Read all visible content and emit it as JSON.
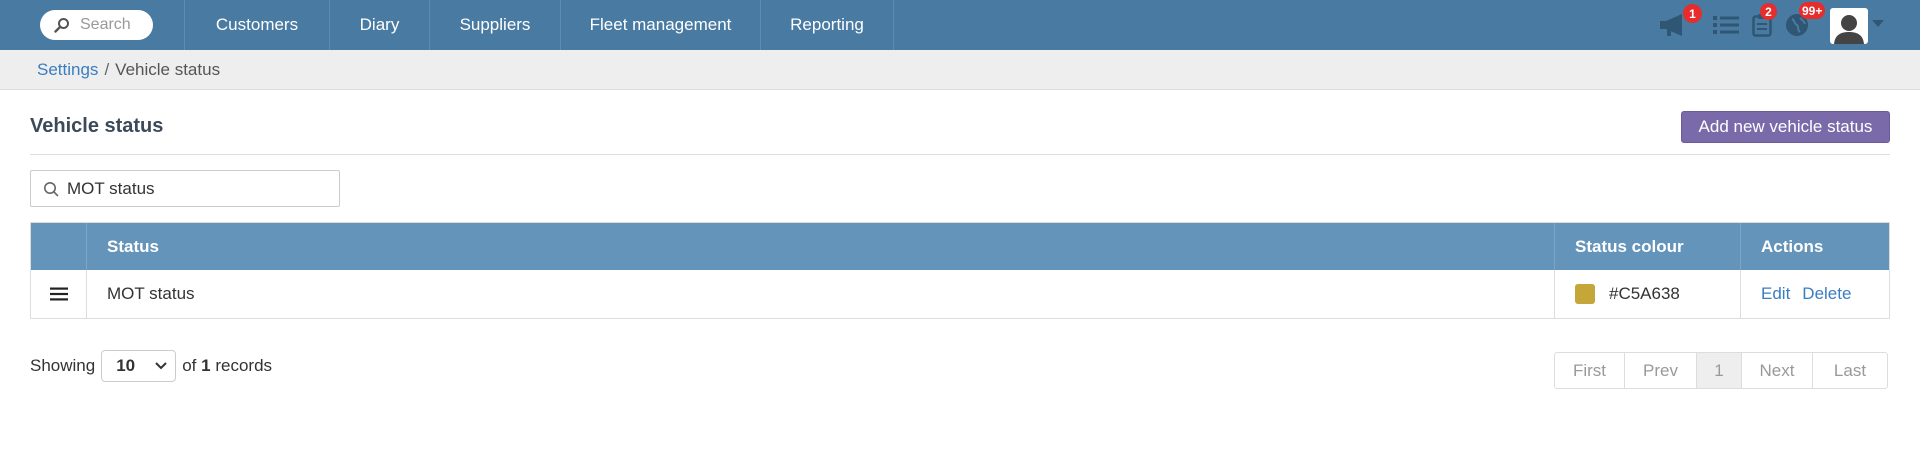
{
  "nav": {
    "search_placeholder": "Search",
    "items": [
      {
        "label": "Customers"
      },
      {
        "label": "Diary"
      },
      {
        "label": "Suppliers"
      },
      {
        "label": "Fleet management"
      },
      {
        "label": "Reporting"
      }
    ],
    "icons": {
      "announcements_badge": "1",
      "list_icon": "list-icon",
      "tasks_badge": "2",
      "globe_badge": "99+"
    }
  },
  "breadcrumb": {
    "parent": "Settings",
    "separator": "/",
    "current": "Vehicle status"
  },
  "page": {
    "title": "Vehicle status",
    "add_button": "Add new vehicle status",
    "filter_value": "MOT status"
  },
  "table": {
    "headers": {
      "status": "Status",
      "status_colour": "Status colour",
      "actions": "Actions"
    },
    "rows": [
      {
        "status": "MOT status",
        "colour_hex": "#C5A638",
        "colour_label": "#C5A638",
        "edit": "Edit",
        "delete": "Delete"
      }
    ]
  },
  "footer": {
    "showing_label": "Showing",
    "page_size": "10",
    "of_label": "of",
    "total": "1",
    "records_label": "records",
    "pager": {
      "first": "First",
      "prev": "Prev",
      "current": "1",
      "next": "Next",
      "last": "Last"
    }
  },
  "colors": {
    "topbar": "#487aa2",
    "table_header": "#6494b9",
    "accent_button": "#7a6aaa",
    "link": "#3a7dc0",
    "badge": "#e52d2d"
  }
}
